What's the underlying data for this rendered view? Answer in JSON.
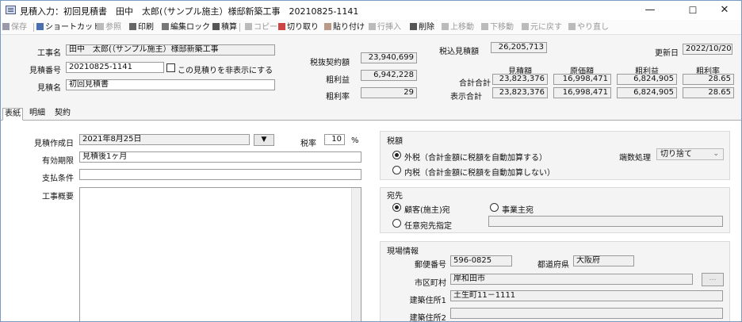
{
  "window": {
    "title": "見積入力：初回見積書　田中　太郎(（サンプル施主）様邸新築工事　20210825-1141",
    "minimize": "—",
    "maximize": "☐",
    "close": "✕"
  },
  "toolbar": {
    "save": "保存",
    "shortcut": "ショートカット",
    "ref": "参照",
    "print": "印刷",
    "lock": "編集ロック",
    "calc": "積算",
    "copy": "コピー",
    "cut": "切り取り",
    "paste": "貼り付け",
    "insert": "行挿入",
    "delete": "削除",
    "up": "上移動",
    "down": "下移動",
    "undo": "元に戻す",
    "redo": "やり直し"
  },
  "header": {
    "project_label": "工事名",
    "project_value": "田中　太郎(（サンプル施主）様邸新築工事",
    "number_label": "見積番号",
    "number_value": "20210825-1141",
    "hide_label": "この見積りを非表示にする",
    "name_label": "見積名",
    "name_value": "初回見積書",
    "pretax_label": "税抜契約額",
    "pretax_value": "23,940,699",
    "profit_label": "粗利益",
    "profit_value": "6,942,228",
    "rate_label": "粗利率",
    "rate_value": "29",
    "taxincl_label": "税込見積額",
    "taxincl_value": "26,205,713",
    "updated_label": "更新日",
    "updated_value": "2022/10/20",
    "col_estimate": "見積額",
    "col_cost": "原価額",
    "col_profit": "粗利益",
    "col_rate": "粗利率",
    "total_label": "合計合計",
    "total": [
      "23,823,376",
      "16,998,471",
      "6,824,905",
      "28.65"
    ],
    "display_label": "表示合計",
    "display": [
      "23,823,376",
      "16,998,471",
      "6,824,905",
      "28.65"
    ]
  },
  "tabs": [
    "表紙",
    "明細",
    "契約"
  ],
  "form": {
    "date_label": "見積作成日",
    "date_value": "2021年8月25日",
    "date_btn": "▼",
    "taxrate_label": "税率",
    "taxrate_value": "10",
    "pct": "%",
    "valid_label": "有効期限",
    "valid_value": "見積後1ヶ月",
    "payment_label": "支払条件",
    "payment_value": "",
    "summary_label": "工事概要",
    "summary_value": ""
  },
  "tax": {
    "title": "税額",
    "opt1": "外税（合計金額に税額を自動加算する）",
    "opt2": "内税（合計金額に税額を自動加算しない）",
    "rounding_label": "端数処理",
    "rounding_value": "切り捨て"
  },
  "recipient": {
    "title": "宛先",
    "opt1": "顧客(施主)宛",
    "opt2": "事業主宛",
    "opt3": "任意宛先指定",
    "custom_value": ""
  },
  "site": {
    "title": "現場情報",
    "zip_label": "郵便番号",
    "zip_value": "596-0825",
    "pref_label": "都道府県",
    "pref_value": "大阪府",
    "city_label": "市区町村",
    "city_value": "岸和田市",
    "addr1_label": "建築住所1",
    "addr1_value": "土生町11－1111",
    "addr2_label": "建築住所2",
    "addr2_value": "",
    "btn": "…"
  }
}
